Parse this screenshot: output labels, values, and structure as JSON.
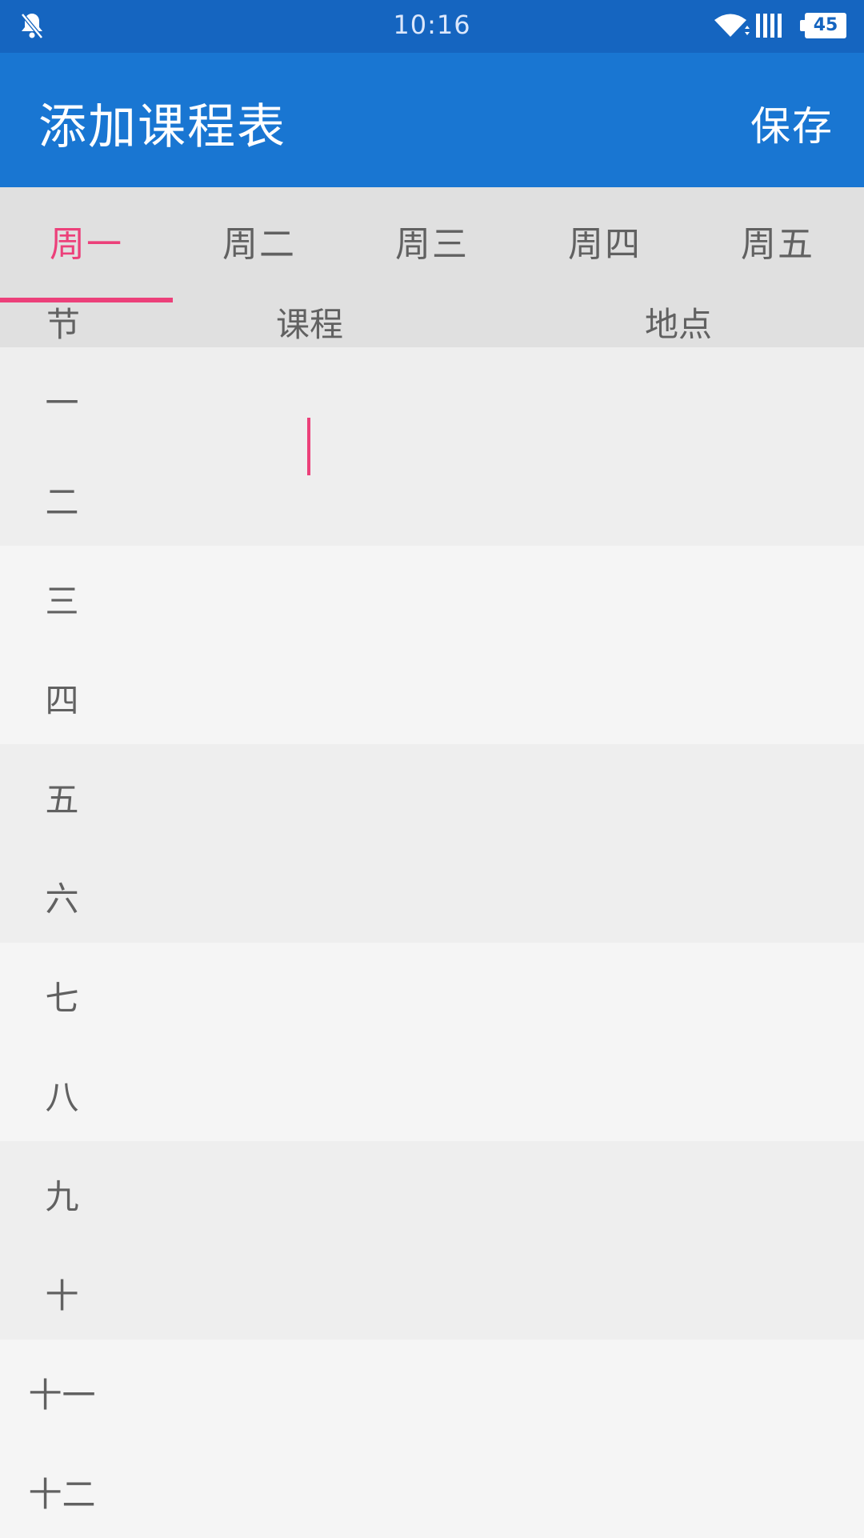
{
  "status_bar": {
    "time": "10:16",
    "battery_level": "45",
    "icons": [
      "bell-off-icon",
      "wifi-icon",
      "signal-icon",
      "battery-icon"
    ]
  },
  "app_bar": {
    "title": "添加课程表",
    "save_label": "保存",
    "color": "#1976d2"
  },
  "tabs": [
    {
      "label": "周一",
      "active": true
    },
    {
      "label": "周二",
      "active": false
    },
    {
      "label": "周三",
      "active": false
    },
    {
      "label": "周四",
      "active": false
    },
    {
      "label": "周五",
      "active": false
    }
  ],
  "accent_color": "#ec407a",
  "columns": {
    "period": "节",
    "course": "课程",
    "location": "地点"
  },
  "periods": [
    "一",
    "二",
    "三",
    "四",
    "五",
    "六",
    "七",
    "八",
    "九",
    "十",
    "十一",
    "十二"
  ]
}
